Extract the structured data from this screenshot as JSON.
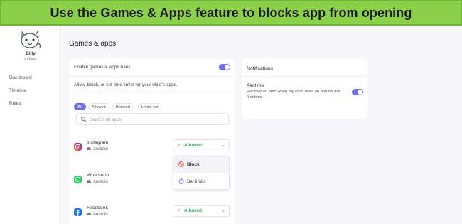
{
  "banner": {
    "text": "Use the Games & Apps feature to blocks app from opening"
  },
  "colors": {
    "accent": "#6e6ee8",
    "success": "#3da55a",
    "banner_bg": "#8cd04a"
  },
  "sidebar": {
    "child": {
      "name": "Billy",
      "status": "Offline"
    },
    "items": [
      {
        "label": "Dashboard"
      },
      {
        "label": "Timeline"
      },
      {
        "label": "Rules"
      }
    ]
  },
  "main": {
    "title": "Games & apps",
    "rules": {
      "enable_label": "Enable games & apps rules",
      "enabled": true,
      "description": "Allow, block, or set time limits for your child's apps.",
      "filters": [
        "All",
        "Allowed",
        "Blocked",
        "Limits set"
      ],
      "active_filter": "All",
      "search_placeholder": "Search all apps",
      "apps": [
        {
          "name": "Instagram",
          "os": "Android",
          "status": "Allowed",
          "icon": "instagram-icon"
        },
        {
          "name": "WhatsApp",
          "os": "Android",
          "status": "",
          "icon": "whatsapp-icon"
        },
        {
          "name": "Facebook",
          "os": "Android",
          "status": "Allowed",
          "icon": "facebook-icon"
        }
      ],
      "dropdown": {
        "options": [
          "Block",
          "Set limits"
        ]
      }
    },
    "notifications": {
      "title": "Notifications",
      "alert_label": "Alert me",
      "alert_desc": "Receive an alert when my child uses an app for the first time.",
      "enabled": true
    }
  }
}
